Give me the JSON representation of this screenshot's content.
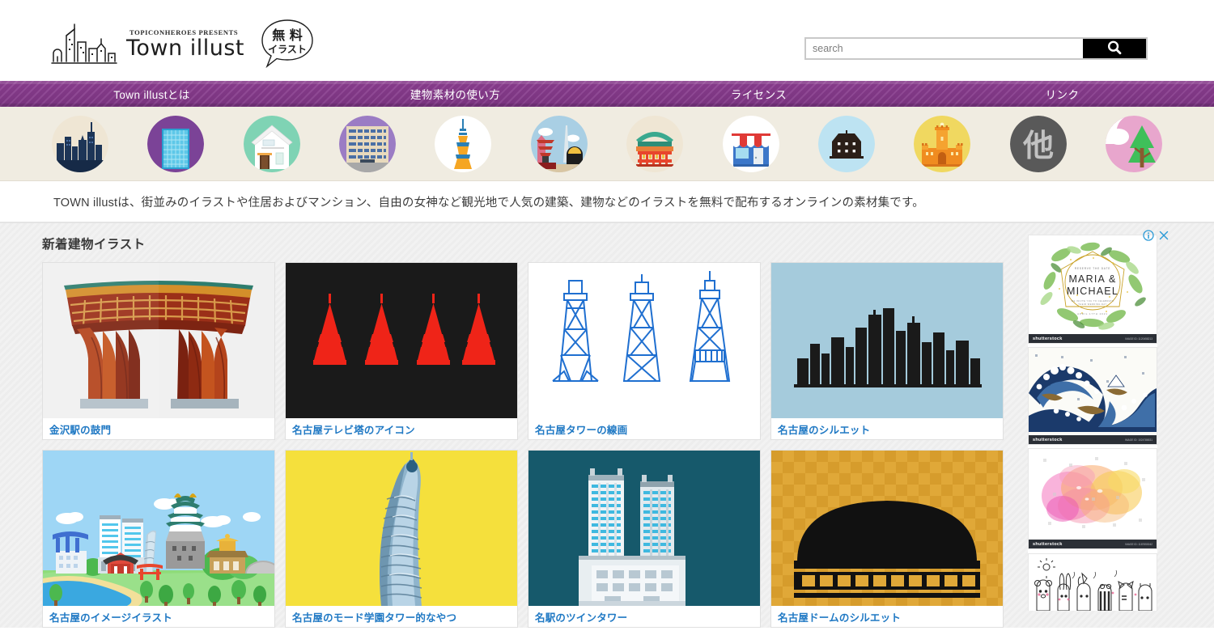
{
  "site": {
    "logo_sup": "TOPICONHEROES PRESENTS",
    "logo_name": "Town illust",
    "badge_top": "無 料",
    "badge_bottom": "イラスト"
  },
  "search": {
    "placeholder": "search",
    "value": "",
    "button_icon": "search-icon"
  },
  "nav": {
    "items": [
      {
        "label": "Town illustとは"
      },
      {
        "label": "建物素材の使い方"
      },
      {
        "label": "ライセンス"
      },
      {
        "label": "リンク"
      }
    ],
    "bg_color": "#8e3f92"
  },
  "categories": [
    {
      "name": "cityscape",
      "bg": "#efe6d4"
    },
    {
      "name": "office-tower",
      "bg": "#7b4397"
    },
    {
      "name": "house",
      "bg": "#7fd3b4"
    },
    {
      "name": "apartment",
      "bg": "#9b7cc4"
    },
    {
      "name": "tv-tower",
      "bg": "#ffffff"
    },
    {
      "name": "pagoda-scene",
      "bg": "#a9cfe4"
    },
    {
      "name": "shrine",
      "bg": "#efe6d4"
    },
    {
      "name": "shop",
      "bg": "#ffffff"
    },
    {
      "name": "warehouse",
      "bg": "#bde3f2"
    },
    {
      "name": "castle-west",
      "bg": "#f0d860"
    },
    {
      "name": "other",
      "bg": "#595959",
      "glyph": "他"
    },
    {
      "name": "nature",
      "bg": "#e8a6cd"
    }
  ],
  "lead": {
    "text": "TOWN illustは、街並みのイラストや住居およびマンション、自由の女神など観光地で人気の建築、建物などのイラストを無料で配布するオンラインの素材集です。"
  },
  "main": {
    "section_title": "新着建物イラスト",
    "cards": [
      {
        "title": "金沢駅の鼓門",
        "art": "tsuzumi-gate",
        "bg": "#f0f0f0"
      },
      {
        "title": "名古屋テレビ塔のアイコン",
        "art": "tv-tower-icons",
        "bg": "#1a1a1a"
      },
      {
        "title": "名古屋タワーの線画",
        "art": "tower-line-art",
        "bg": "#ffffff"
      },
      {
        "title": "名古屋のシルエット",
        "art": "nagoya-silhouette",
        "bg": "#a5cbdc"
      },
      {
        "title": "名古屋のイメージイラスト",
        "art": "nagoya-scene",
        "bg": "#9ed6f5"
      },
      {
        "title": "名古屋のモード学園タワー的なやつ",
        "art": "mode-gakuen-tower",
        "bg": "#f5e03c"
      },
      {
        "title": "名駅のツインタワー",
        "art": "twin-tower",
        "bg": "#16596b"
      },
      {
        "title": "名古屋ドームのシルエット",
        "art": "dome-silhouette",
        "bg": "#e0a838"
      }
    ]
  },
  "ads": {
    "info_icon": "info-icon",
    "close_icon": "close-icon",
    "units": [
      {
        "name": "wedding-invitation-ad",
        "headline_1": "MARIA &",
        "headline_2": "MICHAEL",
        "small_top": "RESERVE THE DATE",
        "small_mid": "WE INVITE YOU TO CELEBRATE THEIR WEDDING DAY",
        "small_bottom": "APRIL 17TH 2021",
        "watermark": "shutterstock",
        "watermark_sub": "IMAGE ID: 1120458213"
      },
      {
        "name": "great-wave-ad",
        "watermark": "shutterstock",
        "watermark_sub": "IMAGE ID: 1024786531"
      },
      {
        "name": "watercolor-splash-ad",
        "watermark": "shutterstock",
        "watermark_sub": "IMAGE ID: 1187653042"
      },
      {
        "name": "doodle-animals-ad",
        "watermark": "",
        "watermark_sub": ""
      }
    ]
  }
}
